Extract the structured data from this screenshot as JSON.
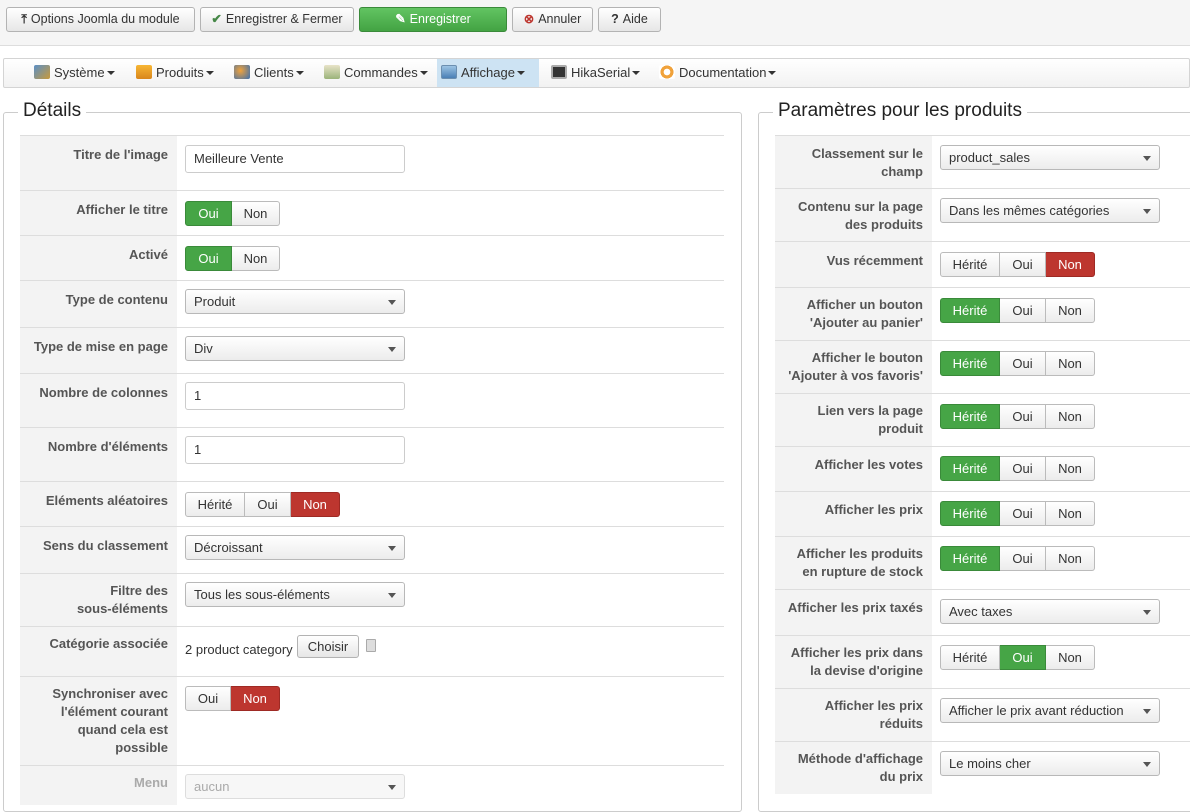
{
  "toolbar": {
    "options": "Options Joomla du module",
    "save_close": "Enregistrer & Fermer",
    "save": "Enregistrer",
    "cancel": "Annuler",
    "help": "Aide"
  },
  "menu": [
    {
      "label": "Système",
      "icon": "wrench-icon"
    },
    {
      "label": "Produits",
      "icon": "box-icon"
    },
    {
      "label": "Clients",
      "icon": "users-icon"
    },
    {
      "label": "Commandes",
      "icon": "orders-icon"
    },
    {
      "label": "Affichage",
      "icon": "display-icon",
      "active": true
    },
    {
      "label": "HikaSerial",
      "icon": "serial-icon"
    },
    {
      "label": "Documentation",
      "icon": "docs-icon"
    }
  ],
  "details": {
    "title": "Détails",
    "image_title_label": "Titre de l'image",
    "image_title_value": "Meilleure Vente",
    "show_title_label": "Afficher le titre",
    "active_label": "Activé",
    "content_type_label": "Type de contenu",
    "content_type_value": "Produit",
    "layout_label": "Type de mise en page",
    "layout_value": "Div",
    "columns_label": "Nombre de colonnes",
    "columns_value": "1",
    "items_label": "Nombre d'éléments",
    "items_value": "1",
    "random_label": "Eléments aléatoires",
    "order_dir_label": "Sens du classement",
    "order_dir_value": "Décroissant",
    "filter_label_1": "Filtre des",
    "filter_label_2": "sous-éléments",
    "filter_value": "Tous les sous-éléments",
    "category_label": "Catégorie associée",
    "category_value": "2 product category",
    "choose": "Choisir",
    "sync_label_1": "Synchroniser avec",
    "sync_label_2": "l'élément courant",
    "sync_label_3": "quand cela est",
    "sync_label_4": "possible",
    "menu_label": "Menu",
    "menu_value": "aucun"
  },
  "params": {
    "title": "Paramètres pour les produits",
    "sort_label_1": "Classement sur le",
    "sort_label_2": "champ",
    "sort_value": "product_sales",
    "content_label_1": "Contenu sur la page",
    "content_label_2": "des produits",
    "content_value": "Dans les mêmes catégories",
    "recent_label": "Vus récemment",
    "cart_label_1": "Afficher un bouton",
    "cart_label_2": "'Ajouter au panier'",
    "fav_label_1": "Afficher le bouton",
    "fav_label_2": "'Ajouter à vos favoris'",
    "link_label_1": "Lien vers la page",
    "link_label_2": "produit",
    "votes_label": "Afficher les votes",
    "prices_label": "Afficher les prix",
    "oos_label_1": "Afficher les produits",
    "oos_label_2": "en rupture de stock",
    "taxed_label": "Afficher les prix taxés",
    "taxed_value": "Avec taxes",
    "orig_label_1": "Afficher les prix dans",
    "orig_label_2": "la devise d'origine",
    "reduced_label_1": "Afficher les prix",
    "reduced_label_2": "réduits",
    "reduced_value": "Afficher le prix avant réduction",
    "method_label_1": "Méthode d'affichage",
    "method_label_2": "du prix",
    "method_value": "Le moins cher"
  },
  "opts": {
    "herite": "Hérité",
    "oui": "Oui",
    "non": "Non"
  }
}
